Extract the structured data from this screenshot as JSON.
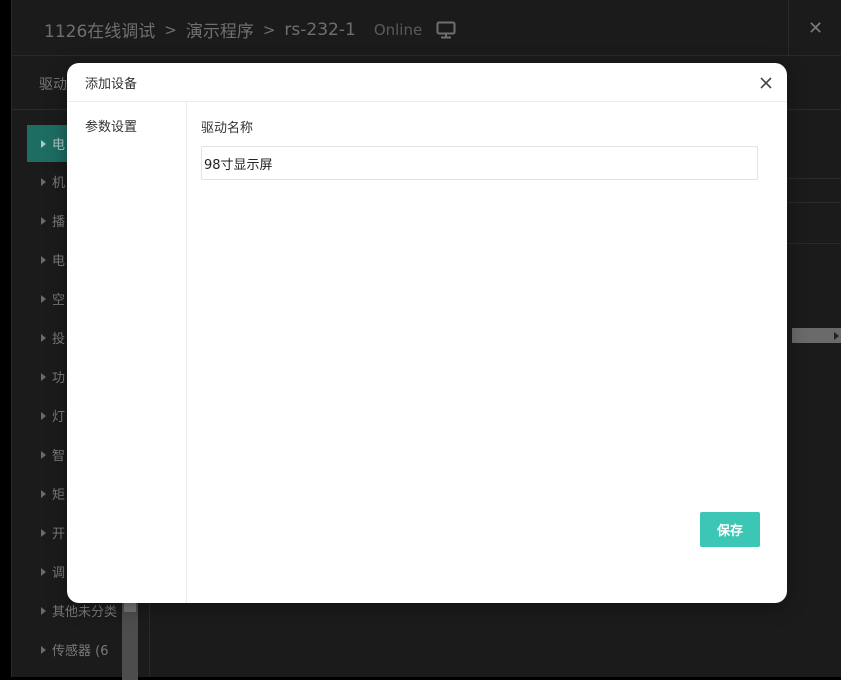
{
  "window": {
    "breadcrumb": [
      "1126在线调试",
      "演示程序",
      "rs-232-1"
    ],
    "breadcrumb_separator": ">",
    "status": "Online",
    "close_label": "✕",
    "tab_label": "驱动"
  },
  "sidebar": {
    "categories": [
      {
        "label": "电"
      },
      {
        "label": "机"
      },
      {
        "label": "播"
      },
      {
        "label": "电"
      },
      {
        "label": "空"
      },
      {
        "label": "投"
      },
      {
        "label": "功"
      },
      {
        "label": "灯"
      },
      {
        "label": "智"
      },
      {
        "label": "矩"
      },
      {
        "label": "开"
      },
      {
        "label": "调"
      },
      {
        "label": "其他未分类"
      },
      {
        "label": "传感器 (6"
      }
    ],
    "active_index": 0
  },
  "dialog": {
    "title": "添加设备",
    "nav_item": "参数设置",
    "field_label": "驱动名称",
    "name_value": "98寸显示屏",
    "save_label": "保存"
  },
  "colors": {
    "accent": "#3cc6b5",
    "active_category": "#1e6d63"
  }
}
